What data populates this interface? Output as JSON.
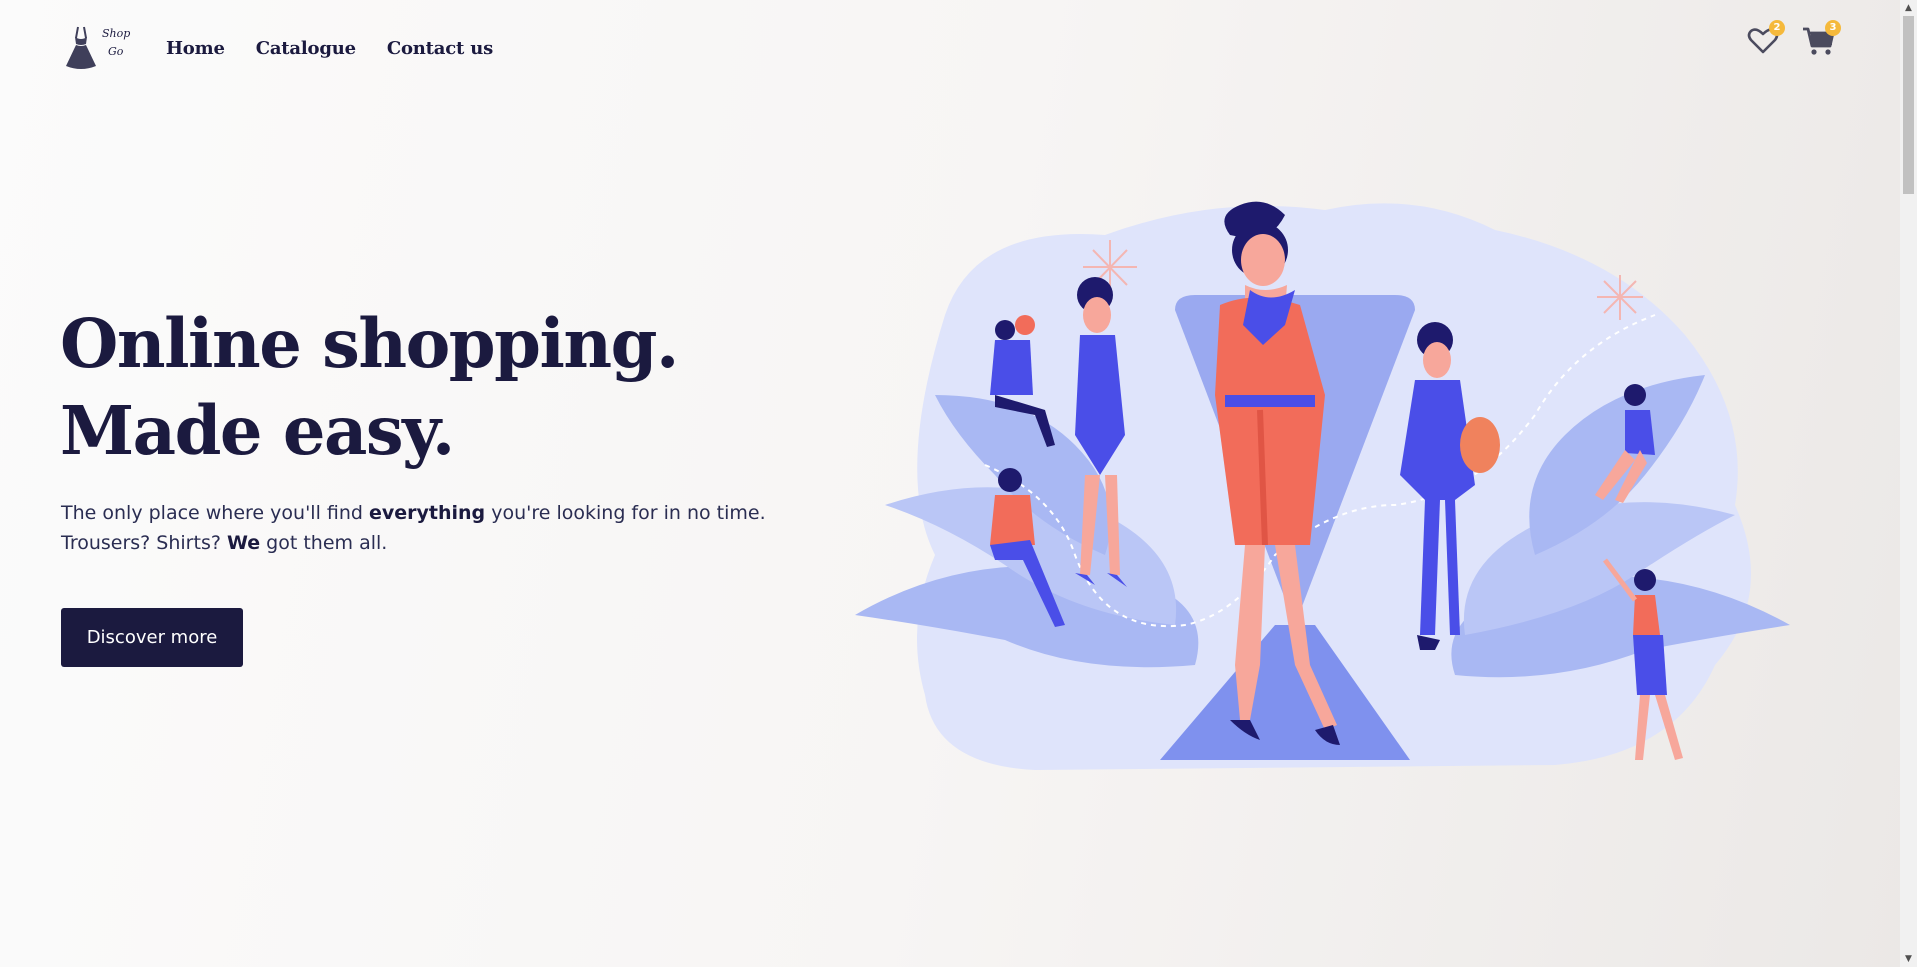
{
  "brand": {
    "logo_line1": "Shop",
    "logo_line2": "Go"
  },
  "nav": {
    "items": [
      {
        "label": "Home"
      },
      {
        "label": "Catalogue"
      },
      {
        "label": "Contact us"
      }
    ]
  },
  "header_icons": {
    "wishlist": {
      "icon": "heart-icon",
      "count": "2"
    },
    "cart": {
      "icon": "cart-icon",
      "count": "3"
    }
  },
  "hero": {
    "title_line1": "Online shopping.",
    "title_line2": "Made easy.",
    "desc": {
      "p1": "The only place where you'll find ",
      "b1": "everything",
      "p2": " you're looking for in no time.",
      "p3": "Trousers? Shirts? ",
      "b2": "We",
      "p4": " got them all."
    },
    "cta_label": "Discover more"
  },
  "colors": {
    "primary": "#1b1a3f",
    "badge": "#f5b93b",
    "accent_blue": "#4a4ee8",
    "accent_coral": "#f26c5a",
    "light_blue": "#c9d3f8"
  }
}
